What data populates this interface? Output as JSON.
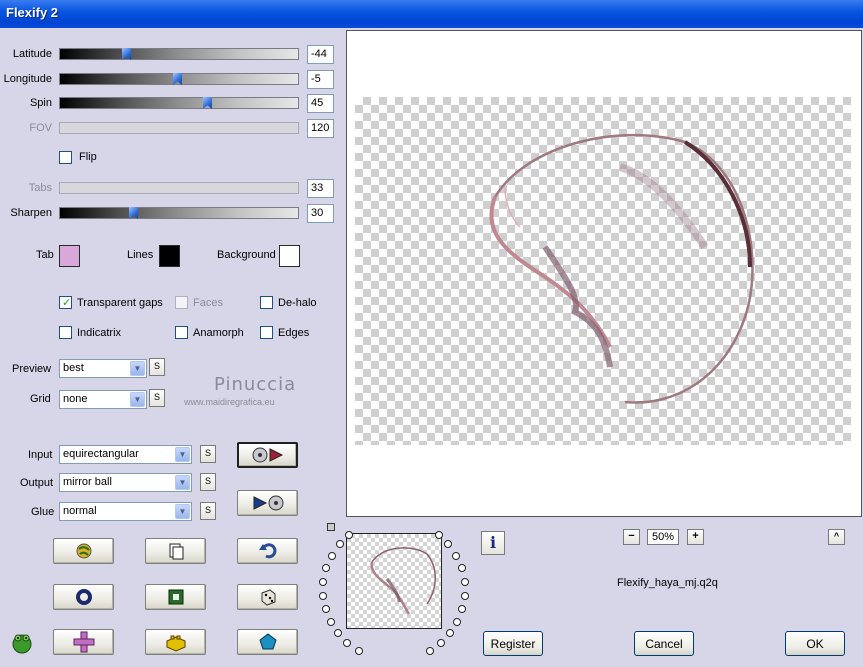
{
  "window": {
    "title": "Flexify 2"
  },
  "sliders": [
    {
      "key": "latitude",
      "label": "Latitude",
      "value": "-44",
      "fraction": 0.27,
      "enabled": true
    },
    {
      "key": "longitude",
      "label": "Longitude",
      "value": "-5",
      "fraction": 0.49,
      "enabled": true
    },
    {
      "key": "spin",
      "label": "Spin",
      "value": "45",
      "fraction": 0.62,
      "enabled": true
    },
    {
      "key": "fov",
      "label": "FOV",
      "value": "120",
      "enabled": false
    },
    {
      "key": "tabs",
      "label": "Tabs",
      "value": "33",
      "enabled": false
    },
    {
      "key": "sharpen",
      "label": "Sharpen",
      "value": "30",
      "fraction": 0.3,
      "enabled": true
    }
  ],
  "flip": {
    "label": "Flip",
    "checked": false
  },
  "colors": {
    "tab": {
      "label": "Tab",
      "hex": "#d8a8d8"
    },
    "lines": {
      "label": "Lines",
      "hex": "#000000"
    },
    "background": {
      "label": "Background",
      "hex": "#ffffff"
    }
  },
  "options": {
    "transparent_gaps": {
      "label": "Transparent gaps",
      "checked": true
    },
    "faces": {
      "label": "Faces",
      "checked": false,
      "enabled": false
    },
    "dehalo": {
      "label": "De-halo",
      "checked": false
    },
    "indicatrix": {
      "label": "Indicatrix",
      "checked": false
    },
    "anamorph": {
      "label": "Anamorph",
      "checked": false
    },
    "edges": {
      "label": "Edges",
      "checked": false
    }
  },
  "preview_select": {
    "label": "Preview",
    "value": "best",
    "s": "S"
  },
  "grid_select": {
    "label": "Grid",
    "value": "none",
    "s": "S"
  },
  "watermark": {
    "name": "Pinuccia",
    "url": "www.maidiregrafica.eu"
  },
  "projection": {
    "input": {
      "label": "Input",
      "value": "equirectangular",
      "s": "S"
    },
    "output": {
      "label": "Output",
      "value": "mirror ball",
      "s": "S"
    },
    "glue": {
      "label": "Glue",
      "value": "normal",
      "s": "S"
    }
  },
  "zoom": {
    "minus": "−",
    "value": "50%",
    "plus": "+"
  },
  "filename": "Flexify_haya_mj.q2q",
  "info_label": "i",
  "scroll_up_label": "^",
  "buttons": {
    "register": "Register",
    "cancel": "Cancel",
    "ok": "OK"
  },
  "accent_color": "#0a56e0"
}
